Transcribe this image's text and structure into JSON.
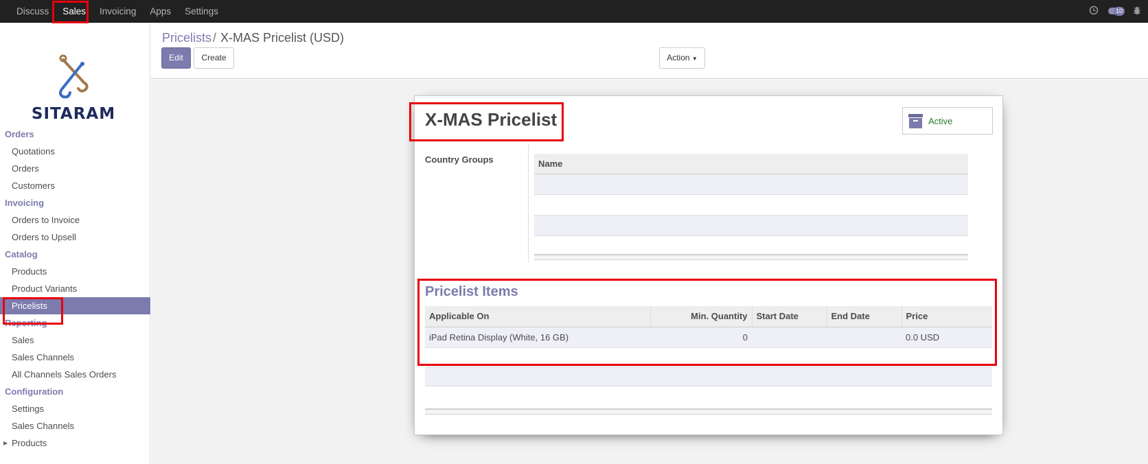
{
  "topbar": {
    "menu": [
      "Discuss",
      "Sales",
      "Invoicing",
      "Apps",
      "Settings"
    ],
    "active": "Sales",
    "message_count": "10"
  },
  "sidebar": {
    "logo_text": "SITARAM",
    "sections": [
      {
        "title": "Orders",
        "items": [
          "Quotations",
          "Orders",
          "Customers"
        ]
      },
      {
        "title": "Invoicing",
        "items": [
          "Orders to Invoice",
          "Orders to Upsell"
        ]
      },
      {
        "title": "Catalog",
        "items": [
          "Products",
          "Product Variants",
          "Pricelists"
        ]
      },
      {
        "title": "Reporting",
        "items": [
          "Sales",
          "Sales Channels",
          "All Channels Sales Orders"
        ]
      },
      {
        "title": "Configuration",
        "items": [
          "Settings",
          "Sales Channels",
          "Products"
        ]
      }
    ],
    "active_item": "Pricelists"
  },
  "breadcrumb": {
    "parent": "Pricelists",
    "separator": "/",
    "current": "X-MAS Pricelist (USD)"
  },
  "buttons": {
    "edit": "Edit",
    "create": "Create",
    "action": "Action"
  },
  "form": {
    "name": "X-MAS Pricelist",
    "active_label": "Active",
    "country_groups_label": "Country Groups",
    "country_groups_columns": [
      "Name"
    ],
    "pricelist_items_title": "Pricelist Items",
    "items_columns": [
      "Applicable On",
      "Min. Quantity",
      "Start Date",
      "End Date",
      "Price"
    ],
    "items": [
      {
        "applicable_on": "iPad Retina Display (White, 16 GB)",
        "min_quantity": "0",
        "start_date": "",
        "end_date": "",
        "price": "0.0 USD"
      }
    ]
  },
  "colors": {
    "accent": "#7c7bad",
    "topbar": "#212121",
    "active_green": "#2d7d2d",
    "highlight": "#e8000b"
  }
}
